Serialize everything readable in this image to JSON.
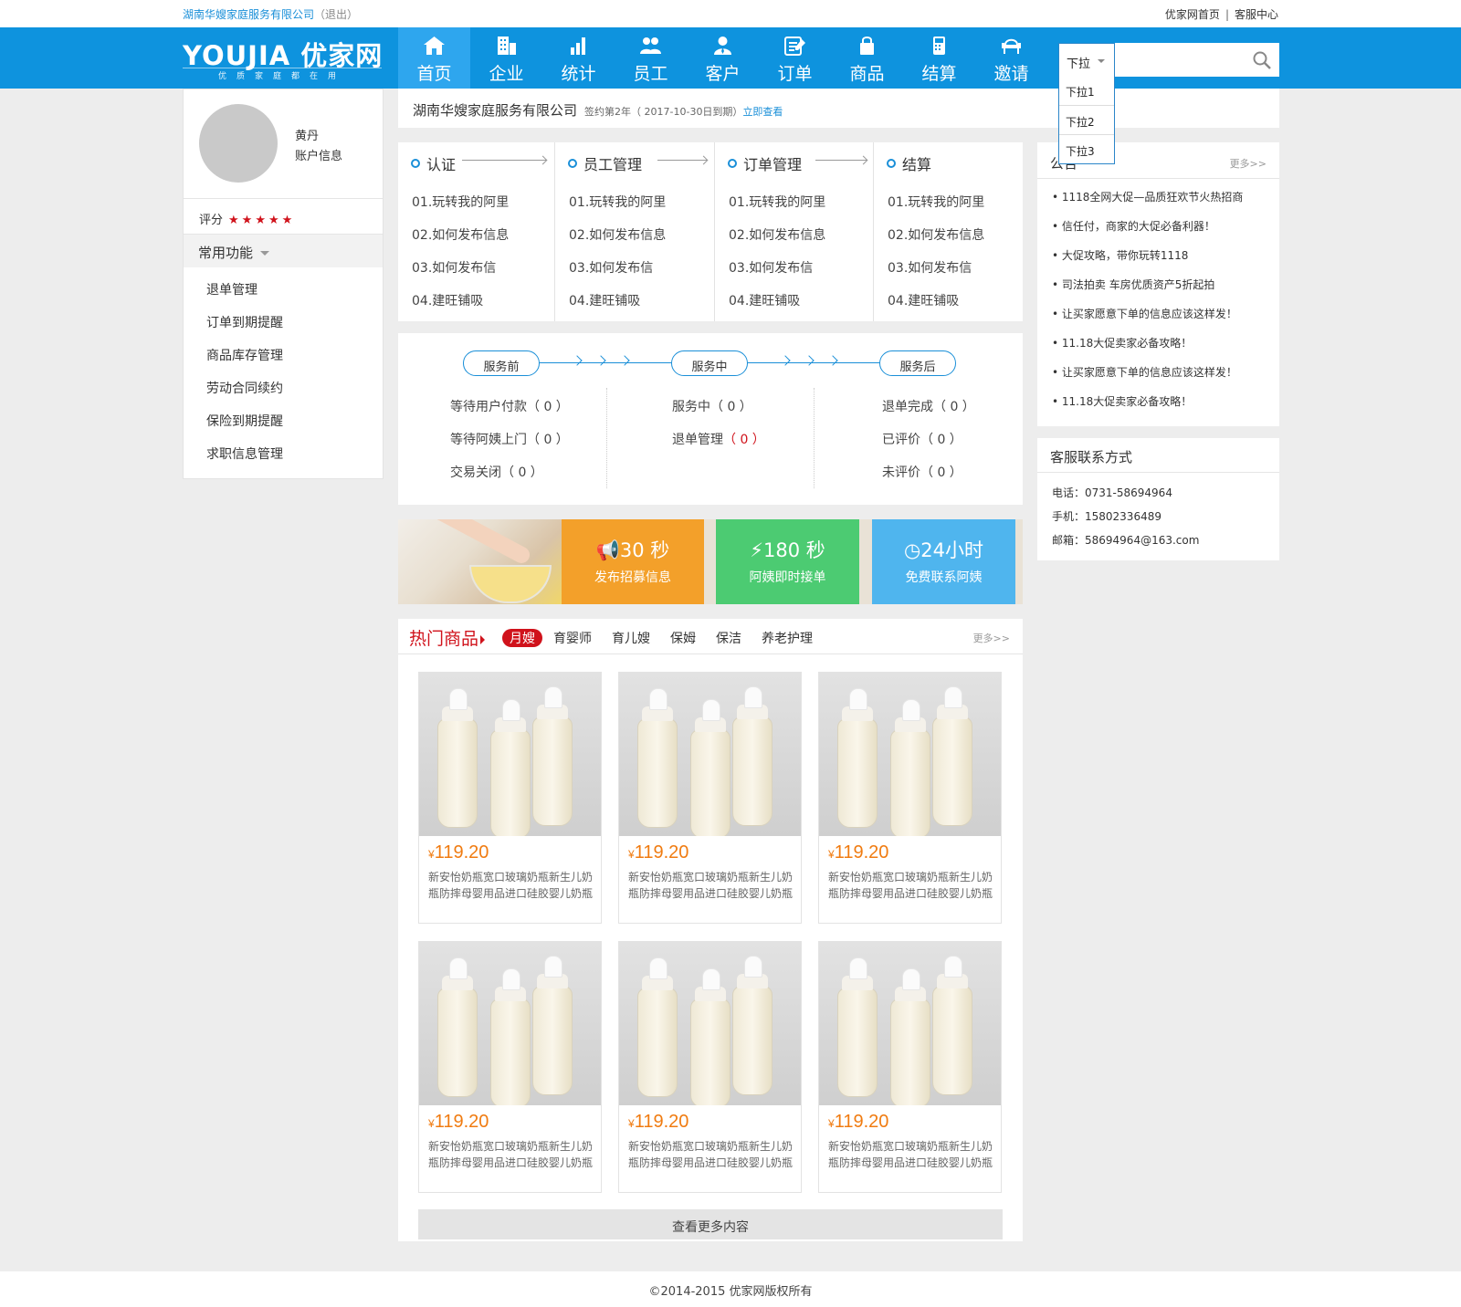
{
  "topbar": {
    "company": "湖南华嫂家庭服务有限公司",
    "logout": "（退出）",
    "home_link": "优家网首页",
    "sep": "|",
    "service_link": "客服中心"
  },
  "logo": {
    "brand": "YOUJIA 优家网",
    "slogan": "优质家庭都在用"
  },
  "nav": [
    {
      "label": "首页",
      "icon": "home-icon",
      "active": true
    },
    {
      "label": "企业",
      "icon": "building-icon"
    },
    {
      "label": "统计",
      "icon": "bar-chart-icon"
    },
    {
      "label": "员工",
      "icon": "users-icon"
    },
    {
      "label": "客户",
      "icon": "customer-icon"
    },
    {
      "label": "订单",
      "icon": "order-icon"
    },
    {
      "label": "商品",
      "icon": "bag-icon"
    },
    {
      "label": "结算",
      "icon": "calculator-icon"
    },
    {
      "label": "邀请",
      "icon": "invite-icon"
    }
  ],
  "search": {
    "select_value": "下拉",
    "options": [
      "下拉1",
      "下拉2",
      "下拉3"
    ],
    "value": "",
    "icon": "search-icon"
  },
  "user": {
    "name": "黄丹",
    "account": "账户信息",
    "rating_label": "评分",
    "stars": "★★★★★",
    "rating": 5
  },
  "sidebar": {
    "section": "常用功能",
    "items": [
      "退单管理",
      "订单到期提醒",
      "商品库存管理",
      "劳动合同续约",
      "保险到期提醒",
      "求职信息管理"
    ]
  },
  "company_bar": {
    "name": "湖南华嫂家庭服务有限公司",
    "sign": "签约第2年（ 2017-10-30日到期）",
    "link": "立即查看"
  },
  "steps": [
    {
      "title": "认证",
      "items": [
        "01.玩转我的阿里",
        "02.如何发布信息",
        "03.如何发布信",
        "04.建旺铺吸"
      ]
    },
    {
      "title": "员工管理",
      "items": [
        "01.玩转我的阿里",
        "02.如何发布信息",
        "03.如何发布信",
        "04.建旺铺吸"
      ]
    },
    {
      "title": "订单管理",
      "items": [
        "01.玩转我的阿里",
        "02.如何发布信息",
        "03.如何发布信",
        "04.建旺铺吸"
      ]
    },
    {
      "title": "结算",
      "items": [
        "01.玩转我的阿里",
        "02.如何发布信息",
        "03.如何发布信",
        "04.建旺铺吸"
      ]
    }
  ],
  "service": {
    "stages": [
      "服务前",
      "服务中",
      "服务后"
    ],
    "before": [
      "等待用户付款（ 0 ）",
      "等待阿姨上门（ 0 ）",
      "交易关闭（ 0 ）"
    ],
    "during_1": "服务中（ 0 ）",
    "during_2_label": "退单管理",
    "during_2_count": "（ 0 ）",
    "after": [
      "退单完成（ 0 ）",
      "已评价（ 0 ）",
      "未评价（ 0 ）"
    ],
    "highlight_color": "#d0121b"
  },
  "promo": [
    {
      "big": "30 秒",
      "small": "发布招募信息",
      "icon": "megaphone-icon",
      "color": "#f3a02a"
    },
    {
      "big": "180 秒",
      "small": "阿姨即时接单",
      "icon": "lightning-icon",
      "color": "#4ccb72"
    },
    {
      "big": "24小时",
      "small": "免费联系阿姨",
      "icon": "clock-icon",
      "color": "#4fb5ee"
    }
  ],
  "hot": {
    "title": "热门商品",
    "tabs": [
      "月嫂",
      "育婴师",
      "育儿嫂",
      "保姆",
      "保洁",
      "养老护理"
    ],
    "more": "更多>>",
    "products": [
      {
        "currency": "¥",
        "price": "119.20",
        "desc": "新安怡奶瓶宽口玻璃奶瓶新生儿奶瓶防摔母婴用品进口硅胶婴儿奶瓶"
      },
      {
        "currency": "¥",
        "price": "119.20",
        "desc": "新安怡奶瓶宽口玻璃奶瓶新生儿奶瓶防摔母婴用品进口硅胶婴儿奶瓶"
      },
      {
        "currency": "¥",
        "price": "119.20",
        "desc": "新安怡奶瓶宽口玻璃奶瓶新生儿奶瓶防摔母婴用品进口硅胶婴儿奶瓶"
      },
      {
        "currency": "¥",
        "price": "119.20",
        "desc": "新安怡奶瓶宽口玻璃奶瓶新生儿奶瓶防摔母婴用品进口硅胶婴儿奶瓶"
      },
      {
        "currency": "¥",
        "price": "119.20",
        "desc": "新安怡奶瓶宽口玻璃奶瓶新生儿奶瓶防摔母婴用品进口硅胶婴儿奶瓶"
      },
      {
        "currency": "¥",
        "price": "119.20",
        "desc": "新安怡奶瓶宽口玻璃奶瓶新生儿奶瓶防摔母婴用品进口硅胶婴儿奶瓶"
      }
    ],
    "load_more": "查看更多内容"
  },
  "notice": {
    "title": "公告",
    "more": "更多>>",
    "items": [
      "• 1118全网大促—品质狂欢节火热招商",
      "• 信任付，商家的大促必备利器！",
      "• 大促攻略，带你玩转1118",
      "• 司法拍卖 车房优质资产5折起拍",
      "• 让买家愿意下单的信息应该这样发！",
      "• 11.18大促卖家必备攻略！",
      "• 让买家愿意下单的信息应该这样发！",
      "• 11.18大促卖家必备攻略！"
    ]
  },
  "contact": {
    "title": "客服联系方式",
    "phone": "电话：0731-58694964",
    "mobile": "手机：15802336489",
    "email": "邮箱：58694964@163.com"
  },
  "footer": "©2014-2015 优家网版权所有",
  "colors": {
    "brand": "#0e93de",
    "accent_red": "#d0121b",
    "price": "#f07b10"
  }
}
